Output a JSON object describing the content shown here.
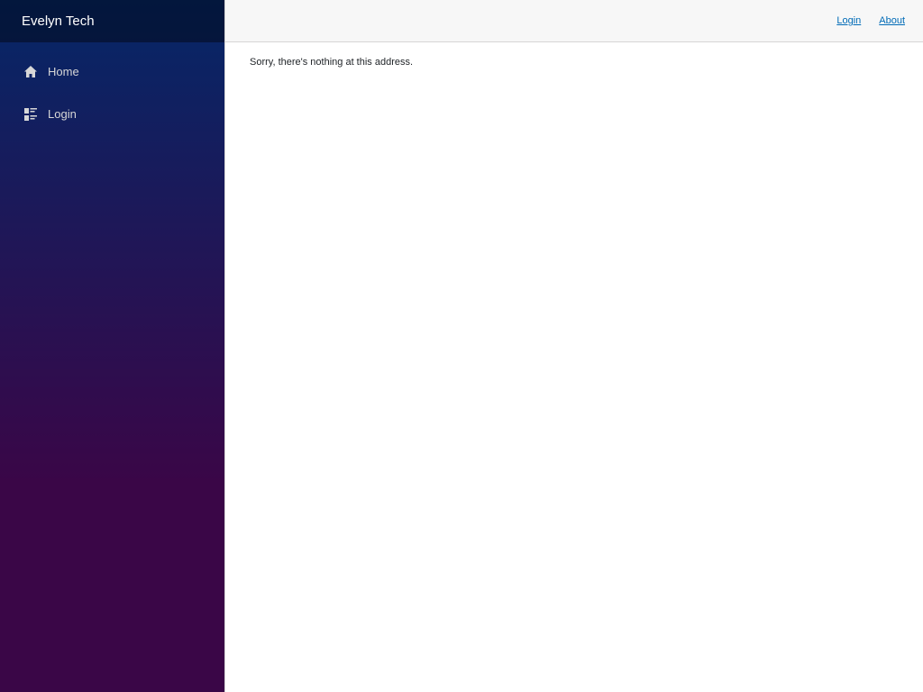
{
  "brand": {
    "name": "Evelyn Tech"
  },
  "sidebar": {
    "items": [
      {
        "label": "Home",
        "icon": "home-icon"
      },
      {
        "label": "Login",
        "icon": "list-rich-icon"
      }
    ]
  },
  "top_row": {
    "links": [
      {
        "label": "Login"
      },
      {
        "label": "About"
      }
    ]
  },
  "content": {
    "message": "Sorry, there's nothing at this address."
  },
  "colors": {
    "sidebar_gradient_start": "#052767",
    "sidebar_gradient_end": "#3a0647",
    "link": "#006bb7",
    "top_row_bg": "#f7f7f7"
  }
}
